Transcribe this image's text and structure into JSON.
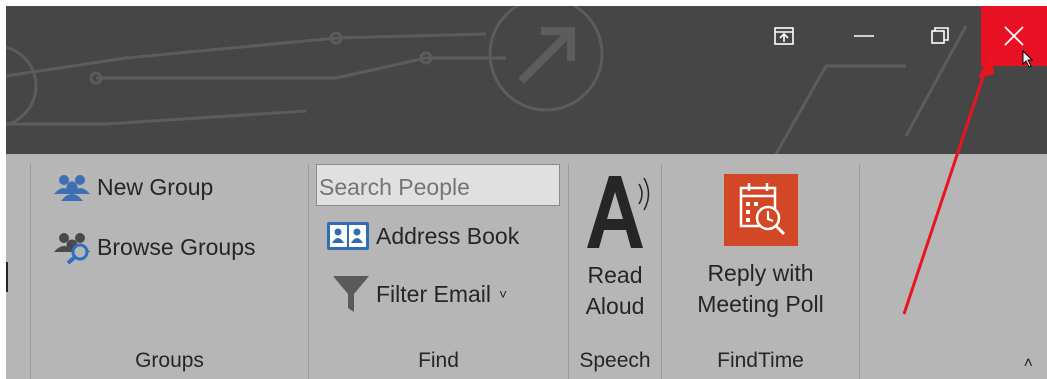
{
  "titlebar": {
    "controls": {
      "ribbon_display_icon": "ribbon-display-options-icon",
      "minimize_icon": "minimize-icon",
      "restore_icon": "restore-icon",
      "close_icon": "close-icon"
    },
    "close_color": "#e81123",
    "background": "#464646"
  },
  "groups": {
    "groups": {
      "label": "Groups",
      "new_group": "New Group",
      "browse_groups": "Browse Groups"
    },
    "find": {
      "label": "Find",
      "search_placeholder": "Search People",
      "address_book": "Address Book",
      "filter_email": "Filter Email",
      "filter_dropdown": "˅"
    },
    "speech": {
      "label": "Speech",
      "read_aloud_line1": "Read",
      "read_aloud_line2": "Aloud"
    },
    "findtime": {
      "label": "FindTime",
      "reply_line1": "Reply with",
      "reply_line2": "Meeting Poll"
    }
  },
  "ribbon": {
    "collapse_glyph": "˄",
    "background": "#b6b6b6"
  },
  "annotation": {
    "arrow_color": "#e8141e"
  }
}
